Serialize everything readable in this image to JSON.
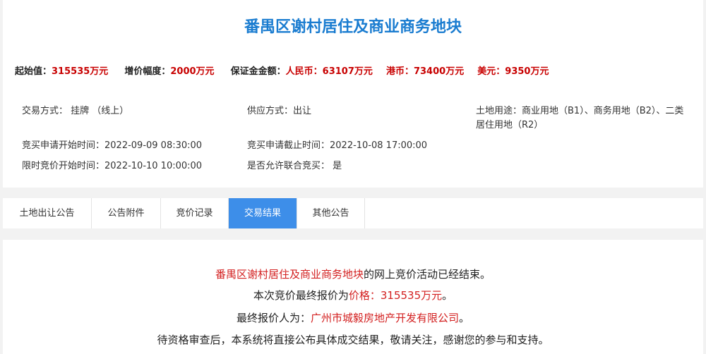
{
  "title": "番禺区谢村居住及商业商务地块",
  "price": {
    "start_label": "起始值：",
    "start_value": "315535万元",
    "increment_label": "增价幅度：",
    "increment_value": "2000万元",
    "deposit_label": "保证金金额：",
    "rmb_label": "人民币：",
    "rmb_value": "63107万元",
    "hkd_label": "港币：",
    "hkd_value": "73400万元",
    "usd_label": "美元：",
    "usd_value": "9350万元"
  },
  "info": {
    "trade_method": "交易方式： 挂牌 （线上）",
    "supply_method": "供应方式：出让",
    "land_use": "土地用途：商业用地（B1）、商务用地（B2）、二类居住用地（R2）",
    "apply_start": "竞买申请开始时间：2022-09-09 08:30:00",
    "apply_end": "竞买申请截止时间：2022-10-08 17:00:00",
    "bid_start": "限时竞价开始时间：2022-10-10 10:00:00",
    "joint_bid": "是否允许联合竞买： 是"
  },
  "tabs": [
    {
      "label": "土地出让公告"
    },
    {
      "label": "公告附件"
    },
    {
      "label": "竞价记录"
    },
    {
      "label": "交易结果"
    },
    {
      "label": "其他公告"
    }
  ],
  "result": {
    "plot_name": "番禺区谢村居住及商业商务地块",
    "line1_suffix": "的网上竞价活动已经结束。",
    "line2_prefix": "本次竞价最终报价为",
    "line2_price": "价格：315535万元",
    "line2_suffix": "。",
    "line3_prefix": "最终报价人为：",
    "line3_winner": "广州市城毅房地产开发有限公司",
    "line3_suffix": "。",
    "line4": "待资格审查后，本系统将直接公布具体成交结果，敬请关注，感谢您的参与和支持。"
  },
  "colors": {
    "title": "#1a7cd0",
    "highlight": "#c80000",
    "active_tab": "#3d8ee9"
  }
}
